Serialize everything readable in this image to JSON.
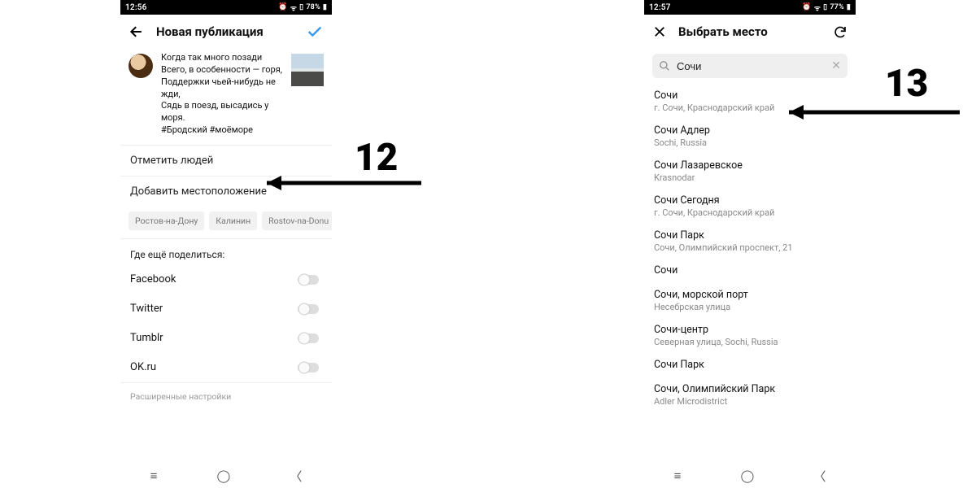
{
  "left": {
    "status": {
      "time": "12:56",
      "battery": "78%"
    },
    "appbar_title": "Новая публикация",
    "caption_lines": [
      "Когда так много позади",
      "Всего, в особенности — горя,",
      "Поддержки чьей-нибудь не жди,",
      "Сядь в поезд, высадись у моря.",
      "#Бродский #моёморе"
    ],
    "tag_people": "Отметить людей",
    "add_location": "Добавить местоположение",
    "chips": [
      "Ростов-на-Дону",
      "Калинин",
      "Rostov-na-Donu"
    ],
    "share_header": "Где ещё поделиться:",
    "share": [
      {
        "label": "Facebook"
      },
      {
        "label": "Twitter"
      },
      {
        "label": "Tumblr"
      },
      {
        "label": "OK.ru"
      }
    ],
    "advanced": "Расширенные настройки"
  },
  "right": {
    "status": {
      "time": "12:57",
      "battery": "77%"
    },
    "appbar_title": "Выбрать место",
    "search_value": "Сочи",
    "results": [
      {
        "title": "Сочи",
        "sub": "г. Сочи, Краснодарский край"
      },
      {
        "title": "Сочи Адлер",
        "sub": "Sochi, Russia"
      },
      {
        "title": "Сочи Лазаревское",
        "sub": "Krasnodar"
      },
      {
        "title": "Сочи Сегодня",
        "sub": "г. Сочи, Краснодарский край"
      },
      {
        "title": "Сочи Парк",
        "sub": "Сочи, Олимпийский проспект, 21"
      },
      {
        "title": "Сочи",
        "sub": ""
      },
      {
        "title": "Сочи, морской порт",
        "sub": "Несебрская улица"
      },
      {
        "title": "Сочи-центр",
        "sub": "Северная улица, Sochi, Russia"
      },
      {
        "title": "Сочи Парк",
        "sub": ""
      },
      {
        "title": "Сочи, Олимпийский Парк",
        "sub": "Adler Microdistrict"
      }
    ]
  },
  "annotations": {
    "left_num": "12",
    "right_num": "13"
  }
}
